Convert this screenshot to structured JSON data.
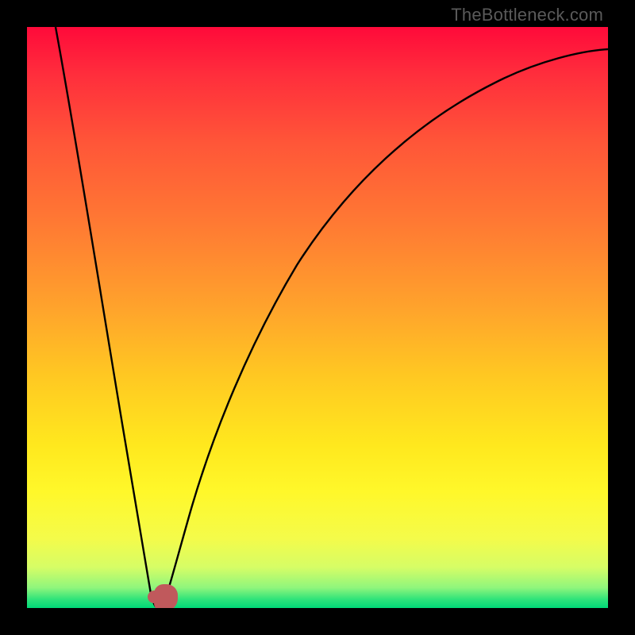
{
  "watermark": "TheBottleneck.com",
  "colors": {
    "frame": "#000000",
    "curve": "#000000",
    "marker": "#c0595c"
  },
  "chart_data": {
    "type": "line",
    "title": "",
    "xlabel": "",
    "ylabel": "",
    "xlim": [
      0,
      100
    ],
    "ylim": [
      0,
      100
    ],
    "background_gradient": "spectral red-to-green (vertical, top=100 bottom=0)",
    "series": [
      {
        "name": "bottleneck-curve-left-branch",
        "x": [
          5,
          8,
          11,
          14,
          17,
          19,
          20.5,
          21.3
        ],
        "y": [
          100,
          78,
          56,
          36,
          18,
          6,
          1.5,
          0.4
        ]
      },
      {
        "name": "bottleneck-curve-right-branch",
        "x": [
          22.7,
          24,
          27,
          31,
          36,
          42,
          49,
          57,
          66,
          76,
          87,
          100
        ],
        "y": [
          0.4,
          2,
          10,
          23,
          38,
          52,
          64,
          74,
          82,
          88,
          92,
          95
        ]
      }
    ],
    "marker": {
      "x": 22,
      "y": 0.6,
      "note": "optimal point marker (red U-shape with dot)"
    }
  }
}
